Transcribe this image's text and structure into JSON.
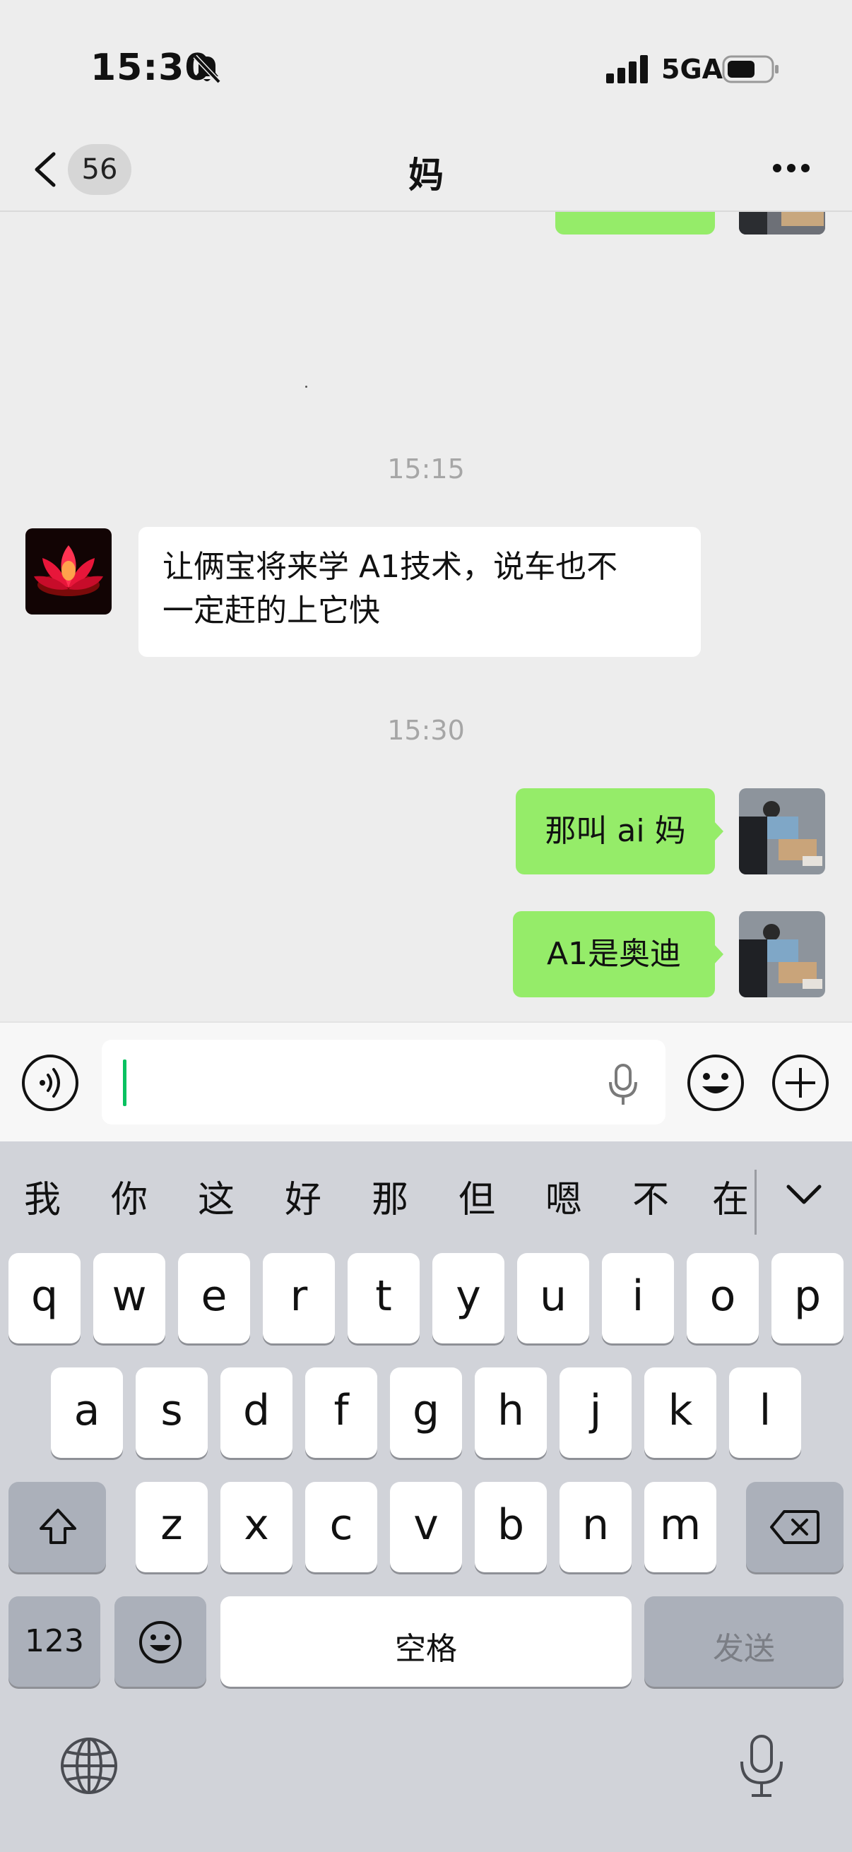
{
  "status_bar": {
    "time": "15:30",
    "network": "5GA"
  },
  "nav": {
    "badge": "56",
    "title": "妈"
  },
  "chat": {
    "timestamps": [
      "15:15",
      "15:30"
    ],
    "messages": [
      {
        "from": "other",
        "text_line1": "让俩宝将来学 A1技术，说车也不",
        "text_line2": "一定赶的上它快"
      },
      {
        "from": "me",
        "text": "那叫 ai 妈"
      },
      {
        "from": "me",
        "text": "A1是奥迪"
      }
    ]
  },
  "input": {
    "value": ""
  },
  "keyboard": {
    "candidates": [
      "我",
      "你",
      "这",
      "好",
      "那",
      "但",
      "嗯",
      "不",
      "在"
    ],
    "row1": [
      "q",
      "w",
      "e",
      "r",
      "t",
      "y",
      "u",
      "i",
      "o",
      "p"
    ],
    "row2": [
      "a",
      "s",
      "d",
      "f",
      "g",
      "h",
      "j",
      "k",
      "l"
    ],
    "row3": [
      "z",
      "x",
      "c",
      "v",
      "b",
      "n",
      "m"
    ],
    "num_label": "123",
    "space_label": "空格",
    "send_label": "发送"
  }
}
